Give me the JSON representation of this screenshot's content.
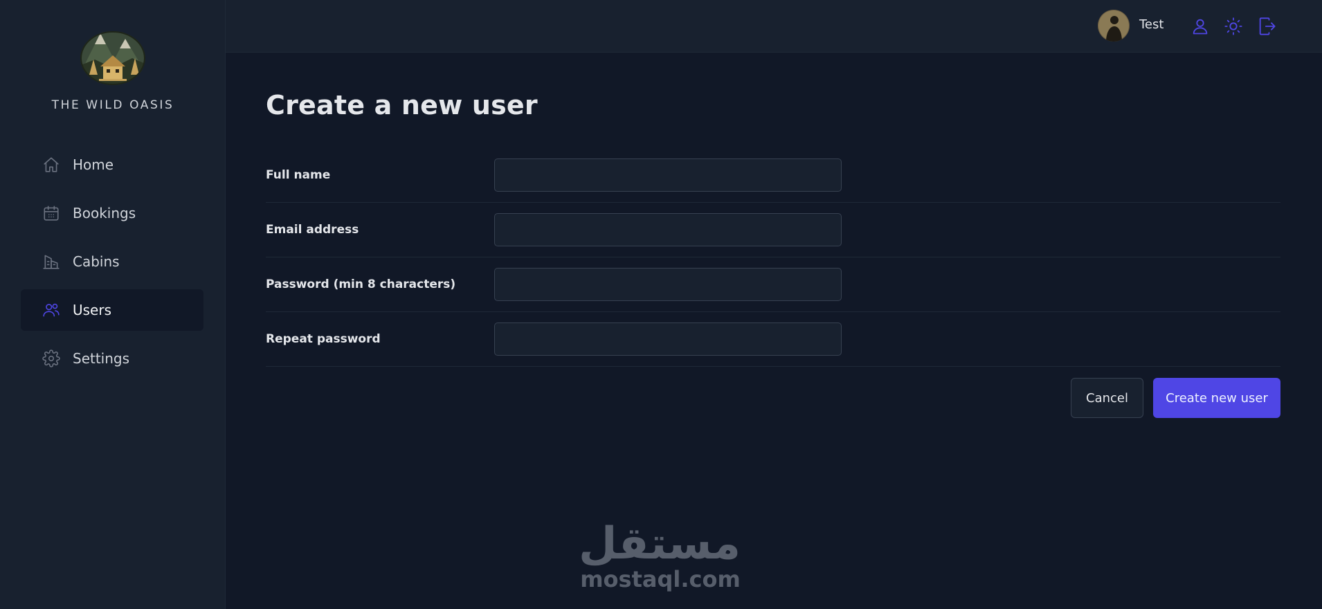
{
  "brand": {
    "name": "THE WILD OASIS"
  },
  "sidebar": {
    "items": [
      {
        "label": "Home",
        "icon": "home-icon",
        "active": false
      },
      {
        "label": "Bookings",
        "icon": "calendar-icon",
        "active": false
      },
      {
        "label": "Cabins",
        "icon": "building-icon",
        "active": false
      },
      {
        "label": "Users",
        "icon": "users-icon",
        "active": true
      },
      {
        "label": "Settings",
        "icon": "gear-icon",
        "active": false
      }
    ]
  },
  "header": {
    "user_name": "Test",
    "icons": [
      "user-icon",
      "sun-icon",
      "logout-icon"
    ]
  },
  "page": {
    "title": "Create a new user"
  },
  "form": {
    "fields": [
      {
        "label": "Full name",
        "value": ""
      },
      {
        "label": "Email address",
        "value": ""
      },
      {
        "label": "Password (min 8 characters)",
        "value": ""
      },
      {
        "label": "Repeat password",
        "value": ""
      }
    ],
    "cancel_label": "Cancel",
    "submit_label": "Create new user"
  },
  "watermark": {
    "arabic": "مستقل",
    "latin": "mostaql.com"
  },
  "colors": {
    "accent": "#4f46e5",
    "sidebar_bg": "#18212f",
    "main_bg": "#111827",
    "border": "#374151"
  }
}
